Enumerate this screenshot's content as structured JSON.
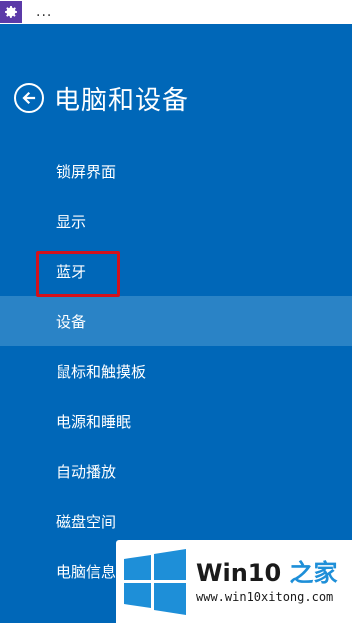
{
  "titlebar": {
    "app_icon": "gear-icon",
    "ellipsis": "..."
  },
  "header": {
    "back_icon": "back-arrow-icon",
    "title": "电脑和设备"
  },
  "menu": {
    "items": [
      {
        "label": "锁屏界面"
      },
      {
        "label": "显示"
      },
      {
        "label": "蓝牙"
      },
      {
        "label": "设备",
        "selected": true
      },
      {
        "label": "鼠标和触摸板"
      },
      {
        "label": "电源和睡眠"
      },
      {
        "label": "自动播放"
      },
      {
        "label": "磁盘空间"
      },
      {
        "label": "电脑信息"
      }
    ]
  },
  "annotation": {
    "highlighted_item": "蓝牙",
    "color": "#d4111b"
  },
  "watermark": {
    "logo_icon": "windows-logo-icon",
    "title_main": "Win10 ",
    "title_accent": "之家",
    "url": "www.win10xitong.com"
  },
  "colors": {
    "background": "#0067b8",
    "selected_row": "#2a83c6",
    "titlebar_icon_bg": "#5b3aa8",
    "brand_accent": "#1e8fd8"
  }
}
